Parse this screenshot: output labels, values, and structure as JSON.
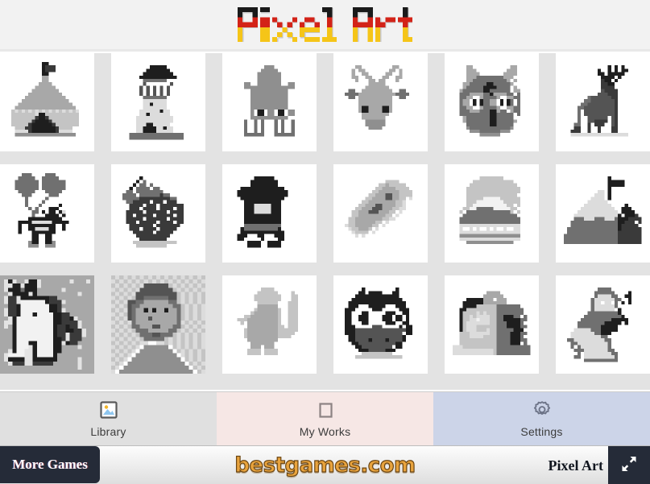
{
  "header": {
    "title": "Pixel Art",
    "title_letters": [
      "P",
      "i",
      "x",
      "e",
      "l",
      " ",
      "A",
      "r",
      "t"
    ],
    "colors": {
      "top": "#1a1a1a",
      "middle": "#d32318",
      "bottom": "#f5c518",
      "background": "#f2f2f2"
    }
  },
  "gallery": {
    "columns": 6,
    "rows": 3,
    "items": [
      {
        "id": 1,
        "name": "circus-tent",
        "label": "Circus Tent"
      },
      {
        "id": 2,
        "name": "lighthouse",
        "label": "Lighthouse"
      },
      {
        "id": 3,
        "name": "squid",
        "label": "Squid"
      },
      {
        "id": 4,
        "name": "deer-head",
        "label": "Deer Head"
      },
      {
        "id": 5,
        "name": "owl-face",
        "label": "Owl Face"
      },
      {
        "id": 6,
        "name": "stag",
        "label": "Stag"
      },
      {
        "id": 7,
        "name": "clown-balloons",
        "label": "Clown with Balloons"
      },
      {
        "id": 8,
        "name": "strawberry",
        "label": "Strawberry"
      },
      {
        "id": 9,
        "name": "ninja",
        "label": "Ninja"
      },
      {
        "id": 10,
        "name": "pizza-slice",
        "label": "Pizza Slice"
      },
      {
        "id": 11,
        "name": "mount-fuji",
        "label": "Mount Fuji"
      },
      {
        "id": 12,
        "name": "mountain-flag",
        "label": "Mountain with Flag"
      },
      {
        "id": 13,
        "name": "unicorn",
        "label": "Unicorn"
      },
      {
        "id": 14,
        "name": "van-gogh-portrait",
        "label": "Van Gogh Portrait"
      },
      {
        "id": 15,
        "name": "cupid",
        "label": "Cupid"
      },
      {
        "id": 16,
        "name": "cartoon-owl",
        "label": "Cartoon Owl"
      },
      {
        "id": 17,
        "name": "mystery-box",
        "label": "Mystery Box"
      },
      {
        "id": 18,
        "name": "musician-dog",
        "label": "Musician with Dog"
      }
    ]
  },
  "tabbar": {
    "tabs": [
      {
        "key": "library",
        "label": "Library",
        "icon": "photo-icon",
        "active": true,
        "bg": "#e0e0e0"
      },
      {
        "key": "myworks",
        "label": "My Works",
        "icon": "square-icon",
        "active": false,
        "bg": "#f6e7e5"
      },
      {
        "key": "settings",
        "label": "Settings",
        "icon": "gear-icon",
        "active": false,
        "bg": "#ccd4e8"
      }
    ]
  },
  "footer": {
    "more_games_label": "More Games",
    "site_logo": "bestgames.com",
    "game_name": "Pixel Art",
    "fullscreen_icon": "fullscreen-expand-icon",
    "bar_color": "#252b38",
    "logo_color": "#e8a33d"
  }
}
